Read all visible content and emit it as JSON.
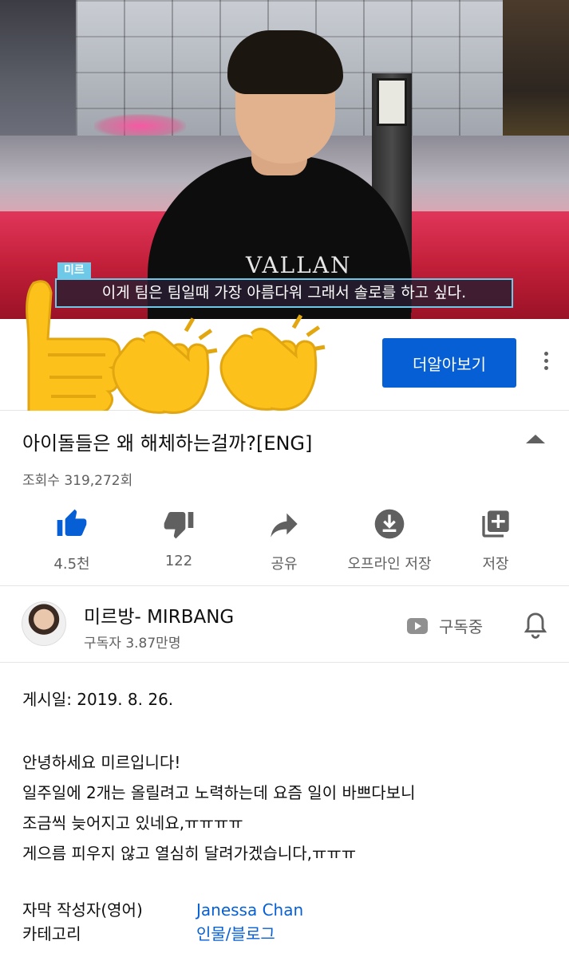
{
  "video": {
    "speaker_tag": "미르",
    "subtitle": "이게 팀은 팀일때 가장 아름다워 그래서 솔로를 하고 싶다.",
    "shirt_text": "VALLAN"
  },
  "promo": {
    "more_button_label": "더알아보기"
  },
  "title": "아이돌들은 왜 해체하는걸까?[ENG]",
  "views": "조회수 319,272회",
  "actions": [
    {
      "icon": "thumbs-up-icon",
      "label": "4.5천"
    },
    {
      "icon": "thumbs-down-icon",
      "label": "122"
    },
    {
      "icon": "share-icon",
      "label": "공유"
    },
    {
      "icon": "download-icon",
      "label": "오프라인 저장"
    },
    {
      "icon": "playlist-add-icon",
      "label": "저장"
    }
  ],
  "channel": {
    "name": "미르방- MIRBANG",
    "subscribers": "구독자 3.87만명",
    "subscribed_label": "구독중"
  },
  "description": {
    "date": "게시일: 2019. 8. 26.",
    "lines": [
      "안녕하세요 미르입니다!",
      "일주일에 2개는 올릴려고 노력하는데 요즘 일이 바쁘다보니",
      "조금씩 늦어지고 있네요,ㅠㅠㅠㅠ",
      "게으름 피우지 않고 열심히 달려가겠습니다,ㅠㅠㅠ"
    ],
    "meta": [
      {
        "key": "자막 작성자(영어)",
        "value": "Janessa Chan"
      },
      {
        "key": "카테고리",
        "value": "인물/블로그"
      }
    ]
  },
  "colors": {
    "accent_blue": "#065fd4",
    "like_blue": "#065fd4",
    "icon_gray": "#606060",
    "emoji_yellow": "#fcc21b"
  }
}
